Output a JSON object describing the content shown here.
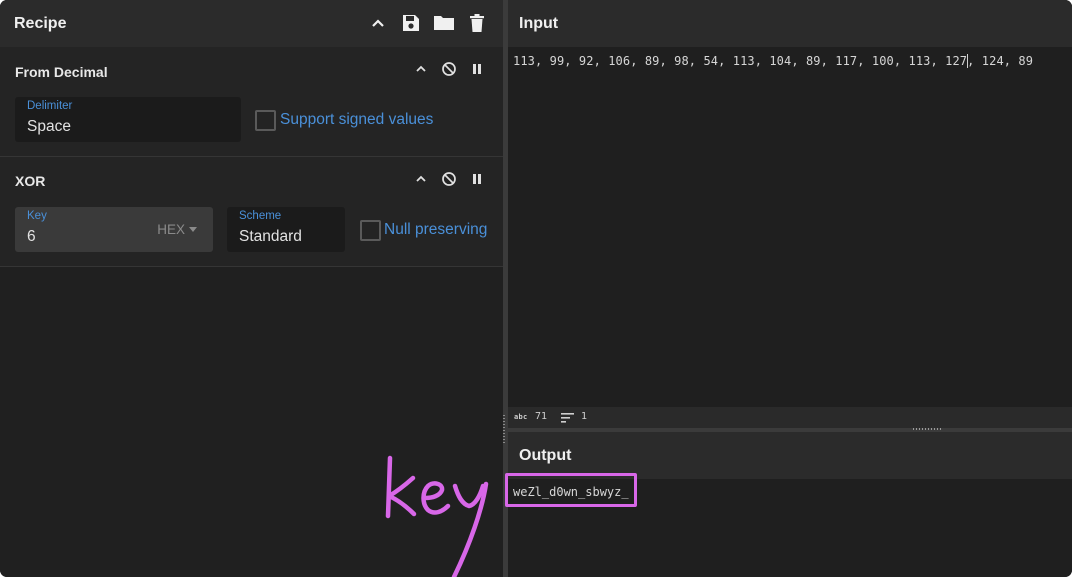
{
  "recipe": {
    "title": "Recipe",
    "icons": [
      "chevron-up-icon",
      "save-icon",
      "folder-icon",
      "trash-icon"
    ],
    "operations": [
      {
        "name": "From Decimal",
        "delimiter_label": "Delimiter",
        "delimiter_value": "Space",
        "signed_label": "Support signed values"
      },
      {
        "name": "XOR",
        "key_label": "Key",
        "key_value": "6",
        "key_format": "HEX",
        "scheme_label": "Scheme",
        "scheme_value": "Standard",
        "null_label": "Null preserving"
      }
    ]
  },
  "input": {
    "title": "Input",
    "text_before_caret": "113, 99, 92, 106, 89, 98, 54, 113, 104, 89, 117, 100, 113, 127",
    "text_after_caret": ", 124, 89",
    "stats": {
      "abc_label": "abc",
      "length": "71",
      "lines": "1"
    }
  },
  "output": {
    "title": "Output",
    "text": "weZl_d0wn_sbwyz_"
  },
  "annotation": {
    "handwritten": "key",
    "color": "#d867e8"
  },
  "colors": {
    "accent": "#4a90d9",
    "background": "#212121",
    "header": "#2b2b2b"
  }
}
